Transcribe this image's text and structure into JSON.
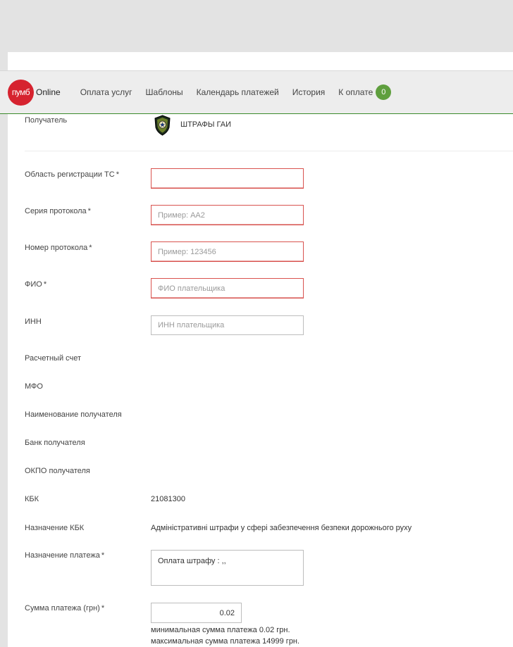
{
  "nav": {
    "logo_mark": "пумб",
    "logo_text": "Online",
    "items": [
      "Оплата услуг",
      "Шаблоны",
      "Календарь платежей",
      "История"
    ],
    "pay_label": "К оплате",
    "pay_count": "0"
  },
  "recipient": {
    "label": "Получатель",
    "name": "ШТРАФЫ ГАИ",
    "icon": "police-badge-icon"
  },
  "form": {
    "region": {
      "label": "Область регистрации ТС",
      "value": "",
      "placeholder": ""
    },
    "series": {
      "label": "Серия протокола",
      "placeholder": "Пример: АА2"
    },
    "number": {
      "label": "Номер протокола",
      "placeholder": "Пример: 123456"
    },
    "fio": {
      "label": "ФИО",
      "placeholder": "ФИО плательщика"
    },
    "inn": {
      "label": "ИНН",
      "placeholder": "ИНН плательщика"
    },
    "account_label": "Расчетный счет",
    "mfo_label": "МФО",
    "recipient_name_label": "Наименование получателя",
    "recipient_bank_label": "Банк получателя",
    "okpo_label": "ОКПО получателя",
    "kbk": {
      "label": "КБК",
      "value": "21081300"
    },
    "kbk_purpose": {
      "label": "Назначение КБК",
      "value": "Адміністративні штрафи у сфері забезпечення безпеки дорожнього руху"
    },
    "purpose": {
      "label": "Назначение платежа",
      "value": "Оплата штрафу : ,,"
    },
    "amount": {
      "label": "Сумма платежа (грн)",
      "value": "0.02",
      "min_hint": "минимальная сумма платежа 0.02 грн.",
      "max_hint": "максимальная сумма платежа 14999 грн."
    },
    "required_mark": "*"
  },
  "colors": {
    "brand_red": "#d6232f",
    "badge_green": "#5f9f3e",
    "nav_border": "#3a8a2a",
    "error_border": "#d9534f"
  }
}
